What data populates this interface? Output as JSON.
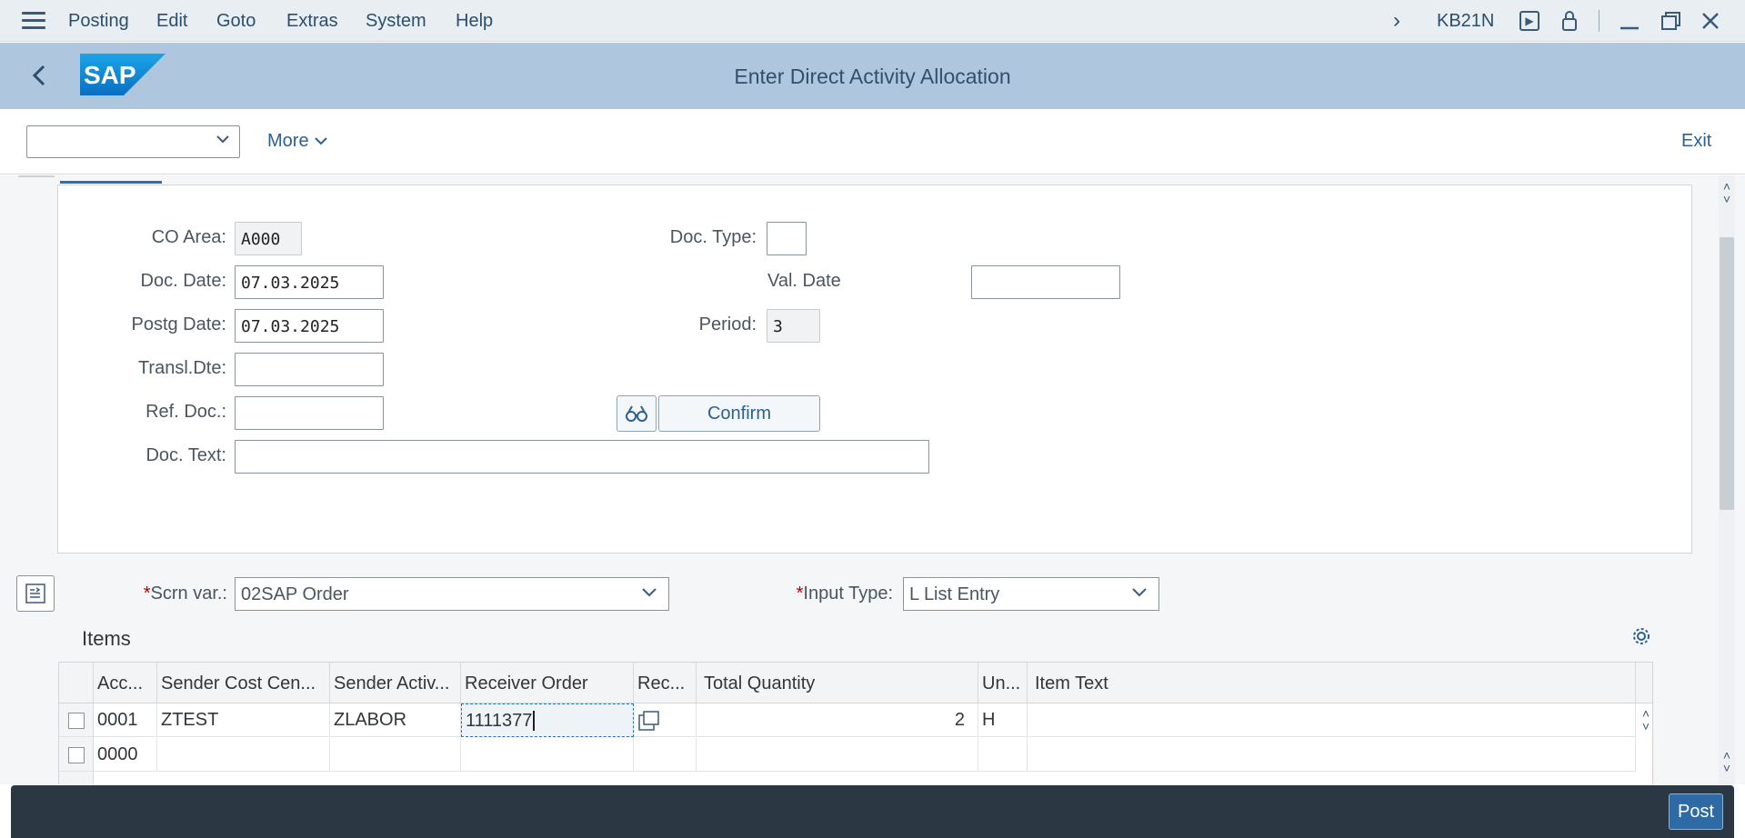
{
  "menubar": {
    "items": [
      "Posting",
      "Edit",
      "Goto",
      "Extras",
      "System",
      "Help"
    ],
    "tcode": "KB21N"
  },
  "header": {
    "title": "Enter Direct Activity Allocation",
    "logo_text": "SAP"
  },
  "toolbar": {
    "dropdown_value": "",
    "more_label": "More",
    "exit_label": "Exit"
  },
  "form": {
    "co_area_label": "CO Area:",
    "co_area_value": "A000",
    "doc_type_label": "Doc. Type:",
    "doc_type_value": "",
    "doc_date_label": "Doc. Date:",
    "doc_date_value": "07.03.2025",
    "val_date_label": "Val. Date",
    "val_date_value": "",
    "postg_date_label": "Postg Date:",
    "postg_date_value": "07.03.2025",
    "period_label": "Period:",
    "period_value": "3",
    "transl_label": "Transl.Dte:",
    "transl_value": "",
    "ref_doc_label": "Ref. Doc.:",
    "ref_doc_value": "",
    "confirm_label": "Confirm",
    "doc_text_label": "Doc. Text:",
    "doc_text_value": ""
  },
  "variant": {
    "required_mark": "*",
    "scrn_var_label": "Scrn var.:",
    "scrn_var_value": "02SAP Order",
    "input_type_label": "Input Type:",
    "input_type_value": "L List Entry"
  },
  "items": {
    "title": "Items",
    "columns": [
      "Acc...",
      "Sender Cost Cen...",
      "Sender Activ...",
      "Receiver Order",
      "Rec...",
      "Total Quantity",
      "Un...",
      "Item Text"
    ],
    "rows": [
      {
        "acc": "0001",
        "sender_cc": "ZTEST",
        "sender_act": "ZLABOR",
        "receiver_order": "1111377",
        "rec": "",
        "total_qty": "2",
        "unit": "H",
        "item_text": ""
      },
      {
        "acc": "0000",
        "sender_cc": "",
        "sender_act": "",
        "receiver_order": "",
        "rec": "",
        "total_qty": "",
        "unit": "",
        "item_text": ""
      }
    ]
  },
  "footer": {
    "post_label": "Post"
  }
}
